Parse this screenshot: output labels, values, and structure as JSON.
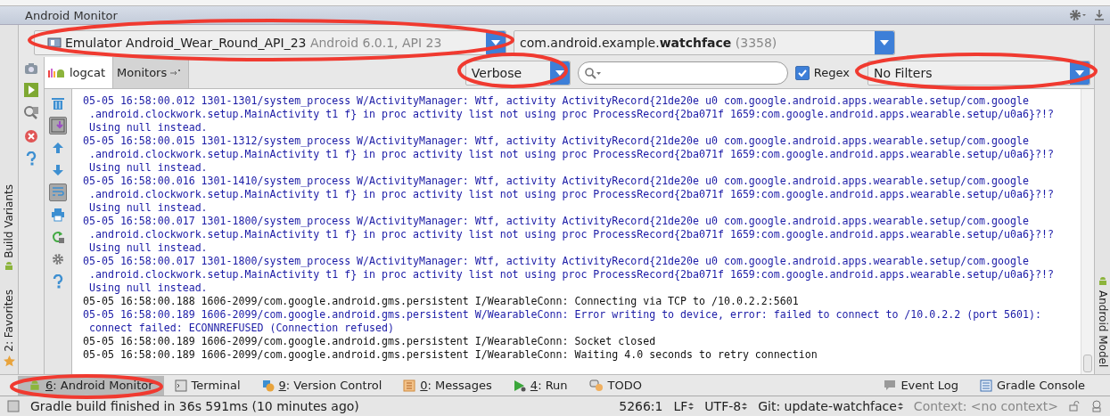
{
  "window": {
    "title": "Android Monitor"
  },
  "device": {
    "name": "Emulator Android_Wear_Round_API_23",
    "detail": "Android 6.0.1, API 23"
  },
  "process": {
    "prefix": "com.android.example.",
    "name": "watchface",
    "pid": "(3358)"
  },
  "side_tools": [
    {
      "kind": "camera"
    },
    {
      "kind": "play"
    },
    {
      "kind": "screen"
    },
    {
      "kind": "close"
    },
    {
      "kind": "help"
    }
  ],
  "tabs": [
    {
      "label": "logcat",
      "selected": true
    },
    {
      "label": "Monitors",
      "selected": false
    }
  ],
  "log_level": "Verbose",
  "regex": {
    "label": "Regex",
    "checked": true
  },
  "filter": "No Filters",
  "log_tools": [
    {
      "kind": "trash",
      "on": false
    },
    {
      "kind": "scroll-end",
      "on": true
    },
    {
      "kind": "up",
      "on": false
    },
    {
      "kind": "down",
      "on": false
    },
    {
      "kind": "wrap",
      "on": true
    },
    {
      "kind": "print",
      "on": false
    },
    {
      "kind": "restart",
      "on": false
    },
    {
      "kind": "gear",
      "on": false
    },
    {
      "kind": "help",
      "on": false
    }
  ],
  "log": [
    {
      "kind": "warning",
      "lines": [
        "05-05 16:58:00.012 1301-1301/system_process W/ActivityManager: Wtf, activity ActivityRecord{21de20e u0 com.google.android.apps.wearable.setup/com.google",
        " .android.clockwork.setup.MainActivity t1 f} in proc activity list not using proc ProcessRecord{2ba071f 1659:com.google.android.apps.wearable.setup/u0a6}?!?",
        " Using null instead."
      ]
    },
    {
      "kind": "warning",
      "lines": [
        "05-05 16:58:00.015 1301-1312/system_process W/ActivityManager: Wtf, activity ActivityRecord{21de20e u0 com.google.android.apps.wearable.setup/com.google",
        " .android.clockwork.setup.MainActivity t1 f} in proc activity list not using proc ProcessRecord{2ba071f 1659:com.google.android.apps.wearable.setup/u0a6}?!?",
        " Using null instead."
      ]
    },
    {
      "kind": "warning",
      "lines": [
        "05-05 16:58:00.016 1301-1410/system_process W/ActivityManager: Wtf, activity ActivityRecord{21de20e u0 com.google.android.apps.wearable.setup/com.google",
        " .android.clockwork.setup.MainActivity t1 f} in proc activity list not using proc ProcessRecord{2ba071f 1659:com.google.android.apps.wearable.setup/u0a6}?!?",
        " Using null instead."
      ]
    },
    {
      "kind": "warning",
      "lines": [
        "05-05 16:58:00.017 1301-1800/system_process W/ActivityManager: Wtf, activity ActivityRecord{21de20e u0 com.google.android.apps.wearable.setup/com.google",
        " .android.clockwork.setup.MainActivity t1 f} in proc activity list not using proc ProcessRecord{2ba071f 1659:com.google.android.apps.wearable.setup/u0a6}?!?",
        " Using null instead."
      ]
    },
    {
      "kind": "warning",
      "lines": [
        "05-05 16:58:00.017 1301-1800/system_process W/ActivityManager: Wtf, activity ActivityRecord{21de20e u0 com.google.android.apps.wearable.setup/com.google",
        " .android.clockwork.setup.MainActivity t1 f} in proc activity list not using proc ProcessRecord{2ba071f 1659:com.google.android.apps.wearable.setup/u0a6}?!?",
        " Using null instead."
      ]
    },
    {
      "kind": "info",
      "lines": [
        "05-05 16:58:00.188 1606-2099/com.google.android.gms.persistent I/WearableConn: Connecting via TCP to /10.0.2.2:5601"
      ]
    },
    {
      "kind": "warning",
      "lines": [
        "05-05 16:58:00.189 1606-2099/com.google.android.gms.persistent W/WearableConn: Error writing to device, error: failed to connect to /10.0.2.2 (port 5601):",
        " connect failed: ECONNREFUSED (Connection refused)"
      ]
    },
    {
      "kind": "info",
      "lines": [
        "05-05 16:58:00.189 1606-2099/com.google.android.gms.persistent I/WearableConn: Socket closed"
      ]
    },
    {
      "kind": "info",
      "lines": [
        "05-05 16:58:00.189 1606-2099/com.google.android.gms.persistent I/WearableConn: Waiting 4.0 seconds to retry connection"
      ]
    }
  ],
  "left_bar": [
    {
      "kind": "build",
      "label": "Build Variants"
    },
    {
      "kind": "favorites",
      "label": "2: Favorites"
    }
  ],
  "right_bar": [
    {
      "kind": "android",
      "label": "Android Model"
    }
  ],
  "bottom_tabs": [
    {
      "kind": "android",
      "hotkey": "6",
      "label": ": Android Monitor",
      "selected": true
    },
    {
      "kind": "terminal",
      "label": "Terminal",
      "selected": false
    },
    {
      "kind": "vcs",
      "hotkey": "9",
      "label": ": Version Control",
      "selected": false
    },
    {
      "kind": "messages",
      "hotkey": "0",
      "label": ": Messages",
      "selected": false
    },
    {
      "kind": "run",
      "hotkey": "4",
      "label": ": Run",
      "selected": false
    },
    {
      "kind": "todo",
      "label": "TODO",
      "selected": false
    }
  ],
  "right_tabs": [
    {
      "kind": "eventlog",
      "label": "Event Log"
    },
    {
      "kind": "gradle",
      "label": "Gradle Console"
    }
  ],
  "status": {
    "message": "Gradle build finished in 36s 591ms (10 minutes ago)",
    "position": "5266:1",
    "line_sep": "LF",
    "encoding": "UTF-8",
    "vcs": "Git: update-watchface",
    "context": "Context: <no context>"
  }
}
